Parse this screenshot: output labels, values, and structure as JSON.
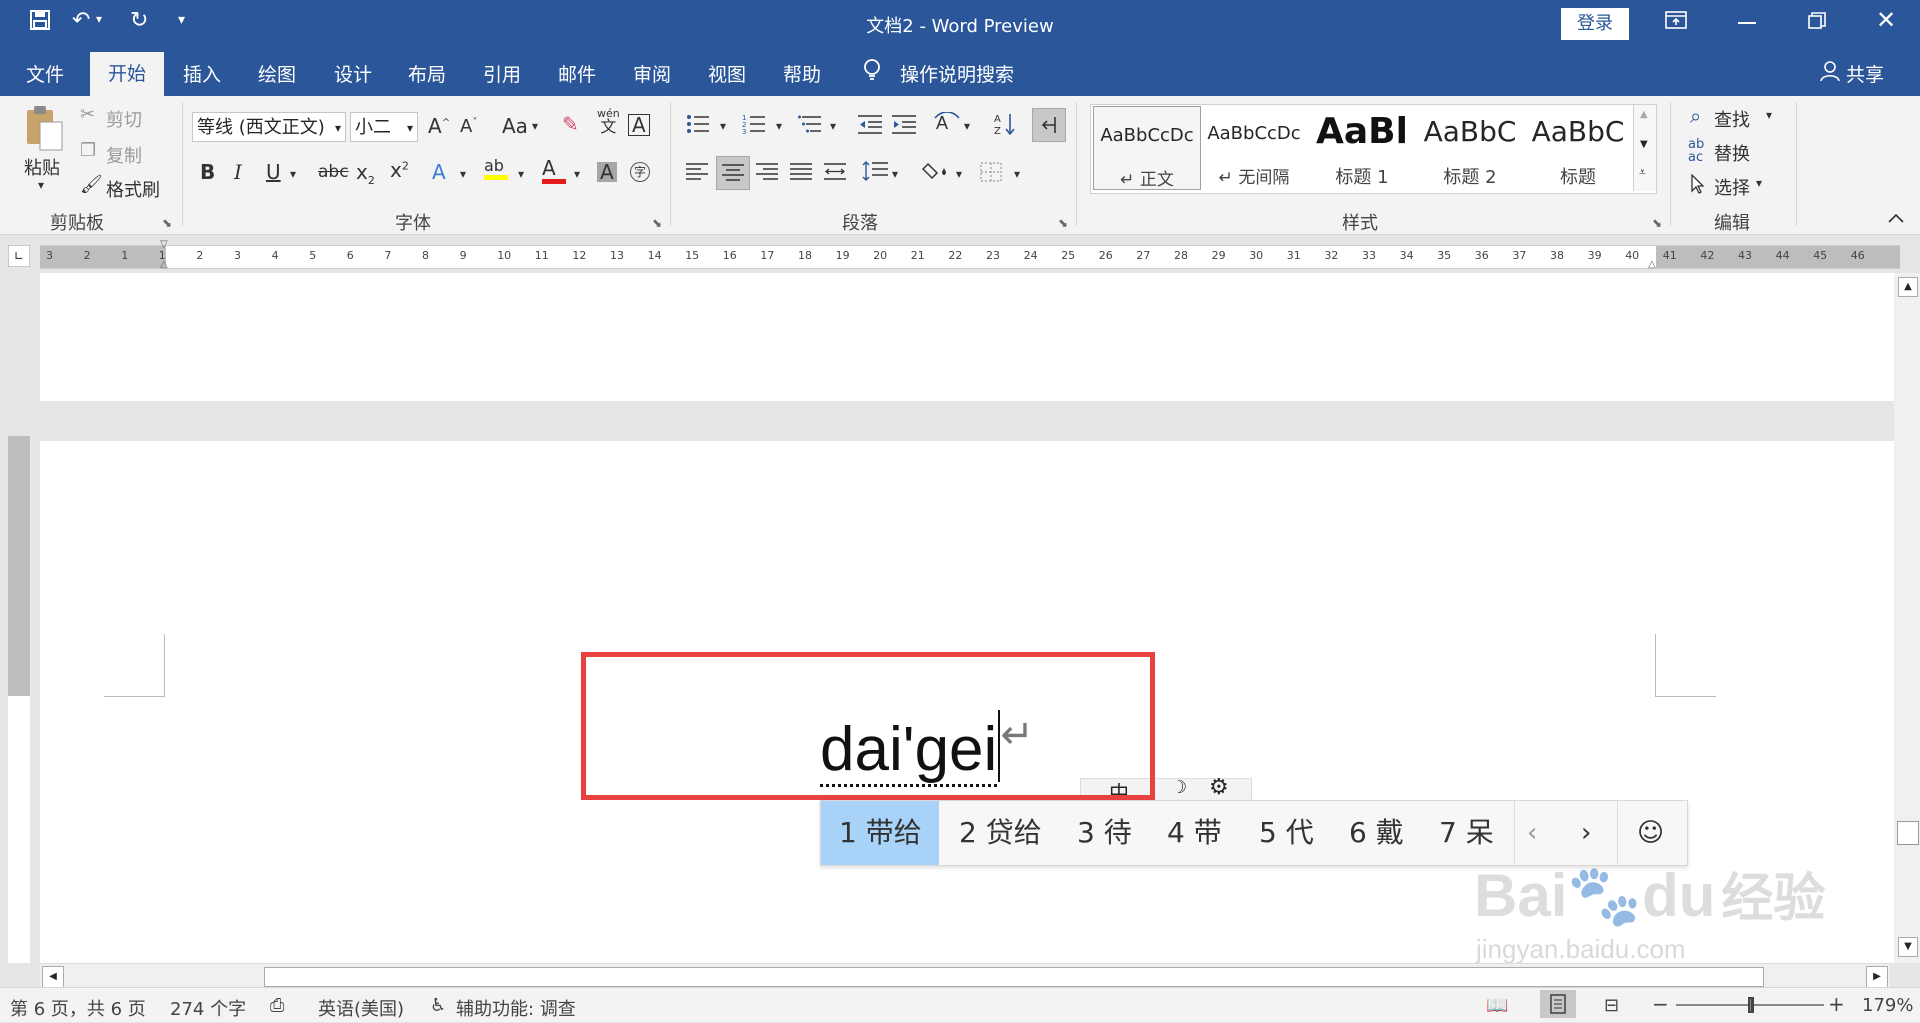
{
  "window": {
    "title": "文档2  -  Word Preview",
    "login_label": "登录"
  },
  "tabs": [
    "文件",
    "开始",
    "插入",
    "绘图",
    "设计",
    "布局",
    "引用",
    "邮件",
    "审阅",
    "视图",
    "帮助"
  ],
  "tell_me": "操作说明搜索",
  "share_label": "共享",
  "clipboard": {
    "paste": "粘贴",
    "cut": "剪切",
    "copy": "复制",
    "format_painter": "格式刷",
    "group_label": "剪贴板"
  },
  "font": {
    "font_name": "等线 (西文正文)",
    "font_size": "小二",
    "change_case": "Aa",
    "phonetic_top": "wén",
    "phonetic_bottom": "文",
    "group_label": "字体",
    "enclose_char": "字"
  },
  "paragraph": {
    "group_label": "段落"
  },
  "styles": {
    "group_label": "样式",
    "items": [
      {
        "sample": "AaBbCcDc",
        "name": "↵ 正文"
      },
      {
        "sample": "AaBbCcDc",
        "name": "↵ 无间隔"
      },
      {
        "sample": "AaBl",
        "name": "标题 1"
      },
      {
        "sample": "AaBbC",
        "name": "标题 2"
      },
      {
        "sample": "AaBbC",
        "name": "标题"
      }
    ]
  },
  "editing": {
    "find": "查找",
    "replace": "替换",
    "select": "选择",
    "group_label": "编辑"
  },
  "ruler_numbers": [
    "3",
    "2",
    "1",
    "1",
    "2",
    "3",
    "4",
    "5",
    "6",
    "7",
    "8",
    "9",
    "10",
    "11",
    "12",
    "13",
    "14",
    "15",
    "16",
    "17",
    "18",
    "19",
    "20",
    "21",
    "22",
    "23",
    "24",
    "25",
    "26",
    "27",
    "28",
    "29",
    "30",
    "31",
    "32",
    "33",
    "34",
    "35",
    "36",
    "37",
    "38",
    "39",
    "40",
    "41",
    "42",
    "43",
    "44",
    "45",
    "46"
  ],
  "document": {
    "typed_text": "dai'gei",
    "pilcrow": "↵"
  },
  "ime": {
    "candidates": [
      "1 带给",
      "2 贷给",
      "3 待",
      "4 带",
      "5 代",
      "6 戴",
      "7 呆"
    ],
    "selected_index": 0
  },
  "status": {
    "page": "第 6 页，共 6 页",
    "words": "274 个字",
    "language": "英语(美国)",
    "accessibility": "辅助功能: 调查",
    "zoom": "179%"
  },
  "watermark": {
    "brand": "Bai",
    "brand2": "du",
    "cn": "经验",
    "url": "jingyan.baidu.com"
  },
  "colors": {
    "titlebar": "#2b579a",
    "highlight_box": "#e94040",
    "ime_selected": "#a9d2f8"
  }
}
